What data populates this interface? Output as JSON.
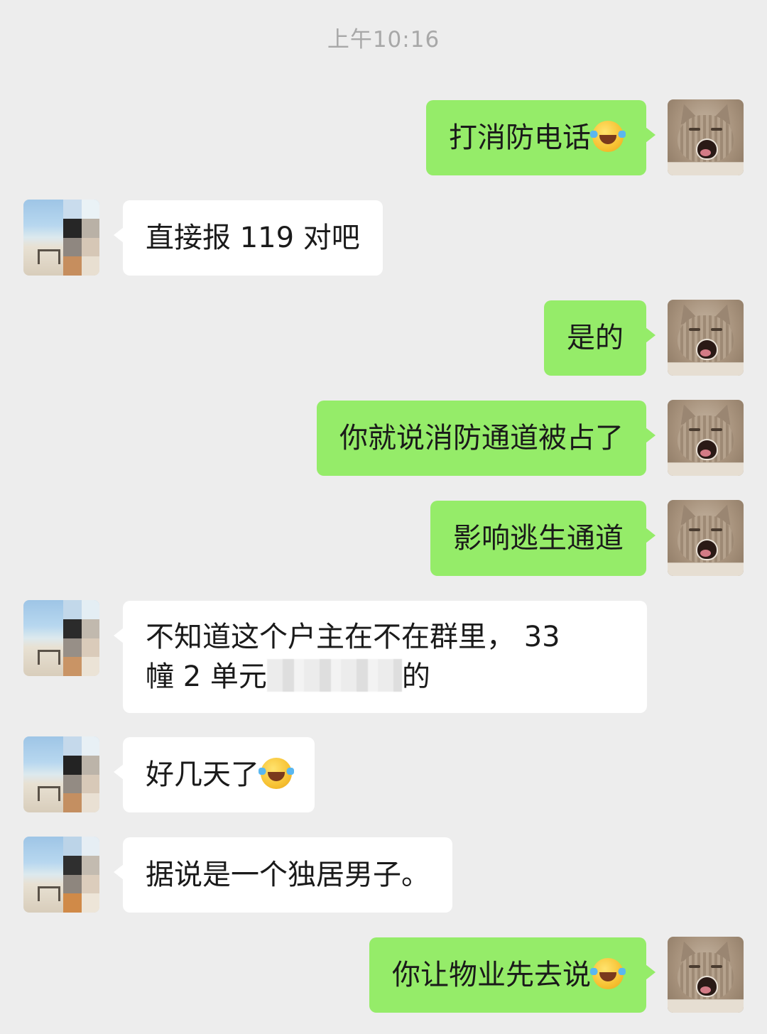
{
  "chat": {
    "timestamp": "上午10:16",
    "messages": [
      {
        "side": "me",
        "text": "打消防电话",
        "emoji": "laughing-crying-emoji"
      },
      {
        "side": "other",
        "text": "直接报 119 对吧"
      },
      {
        "side": "me",
        "text": "是的"
      },
      {
        "side": "me",
        "text": "你就说消防通道被占了"
      },
      {
        "side": "me",
        "text": "影响逃生通道"
      },
      {
        "side": "other",
        "line1": "不知道这个户主在不在群里， 33",
        "line2_start": "幢 2 单元",
        "line2_end": "的"
      },
      {
        "side": "other",
        "text": "好几天了",
        "emoji": "facepalm-crying-emoji"
      },
      {
        "side": "other",
        "text": "据说是一个独居男子。"
      },
      {
        "side": "me",
        "text": "你让物业先去说",
        "emoji": "laughing-crying-emoji"
      }
    ]
  },
  "colors": {
    "background": "#ededed",
    "my_bubble": "#95ec69",
    "their_bubble": "#ffffff",
    "timestamp_text": "#a8a8a8"
  }
}
